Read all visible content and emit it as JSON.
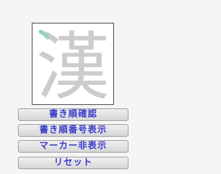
{
  "canvas": {
    "character": "漢",
    "stroke_color": "#9ad3b8",
    "char_color": "#cccccc"
  },
  "buttons": {
    "check_stroke_order": "書き順確認",
    "show_stroke_numbers": "書き順番号表示",
    "hide_marker": "マーカー非表示",
    "reset": "リセット"
  }
}
